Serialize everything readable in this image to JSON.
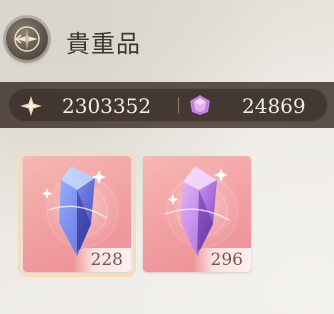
{
  "header": {
    "title": "貴重品",
    "back_icon": "compass-star-back-icon"
  },
  "currencies": [
    {
      "icon": "star-crystal-icon",
      "value": "2303352",
      "color": "#e8d8b4"
    },
    {
      "icon": "pink-gem-icon",
      "value": "24869",
      "color": "#c77ad6"
    }
  ],
  "items": [
    {
      "name": "blue crystal",
      "icon": "blue-crystal-icon",
      "count": "228",
      "selected": true,
      "color": "#7a86e8"
    },
    {
      "name": "purple crystal",
      "icon": "purple-crystal-icon",
      "count": "296",
      "selected": false,
      "color": "#b678e0"
    }
  ]
}
